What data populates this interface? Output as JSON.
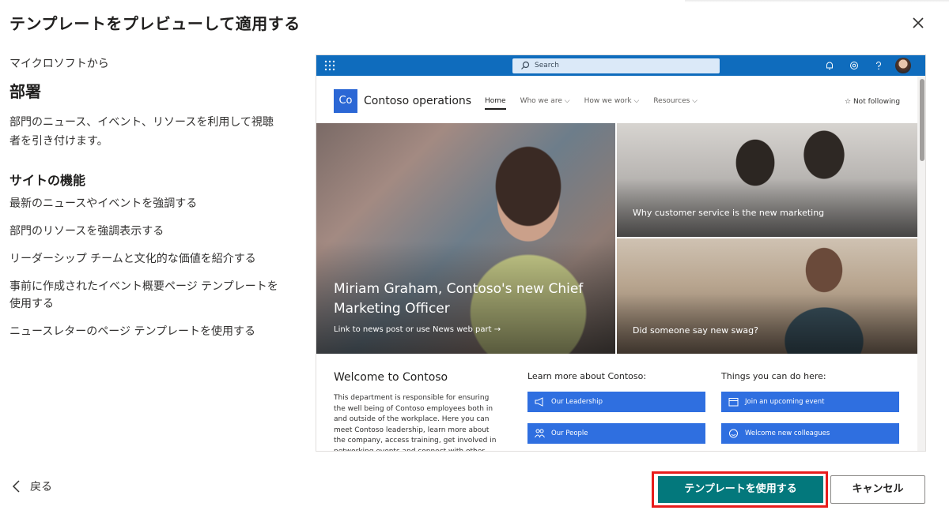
{
  "dialog": {
    "title": "テンプレートをプレビューして適用する"
  },
  "template": {
    "from": "マイクロソフトから",
    "name": "部署",
    "description": "部門のニュース、イベント、リソースを利用して視聴者を引き付けます。",
    "features_heading": "サイトの機能",
    "features": [
      "最新のニュースやイベントを強調する",
      "部門のリソースを強調表示する",
      "リーダーシップ チームと文化的な価値を紹介する",
      "事前に作成されたイベント概要ページ テンプレートを使用する",
      "ニュースレターのページ テンプレートを使用する"
    ]
  },
  "preview": {
    "search_placeholder": "Search",
    "site_logo": "Co",
    "site_name": "Contoso operations",
    "nav": [
      "Home",
      "Who we are",
      "How we work",
      "Resources"
    ],
    "follow": "Not following",
    "hero_main_title": "Miriam Graham, Contoso's new Chief Marketing Officer",
    "hero_main_link": "Link to news post or use News web part →",
    "hero_top_right": "Why customer service is the new marketing",
    "hero_bottom_right": "Did someone say new swag?",
    "welcome_heading": "Welcome to Contoso",
    "welcome_text": "This department is responsible for ensuring the well being of Contoso employees both in and outside of the workplace. Here you can meet Contoso leadership, learn more about the company, access training, get involved in networking events and connect with other",
    "learn_heading": "Learn more about Contoso:",
    "learn_links": [
      "Our Leadership",
      "Our People"
    ],
    "things_heading": "Things you can do here:",
    "things_links": [
      "Join an upcoming event",
      "Welcome new colleagues"
    ]
  },
  "footer": {
    "back_label": "戻る",
    "use_label": "テンプレートを使用する",
    "cancel_label": "キャンセル"
  },
  "colors": {
    "primary": "#03787c",
    "suitebar": "#0f6cbd",
    "highlight": "#e81c1c"
  }
}
